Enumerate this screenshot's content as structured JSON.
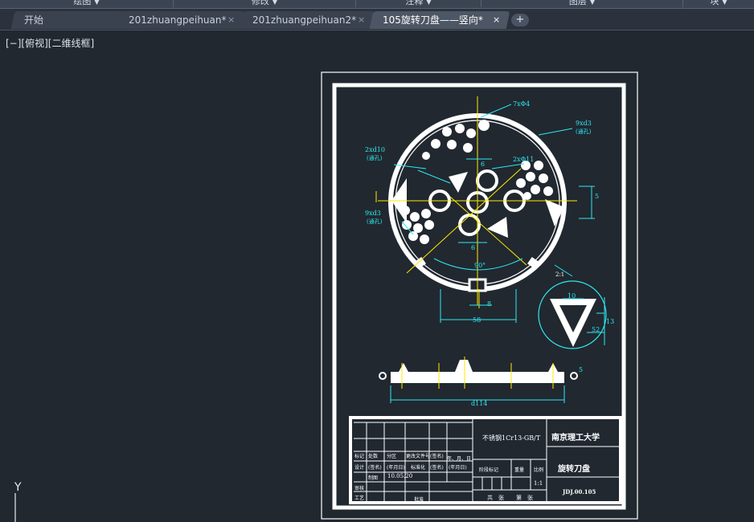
{
  "ribbon": {
    "panels": [
      {
        "label": "绘图"
      },
      {
        "label": "修改"
      },
      {
        "label": "注释"
      },
      {
        "label": "图层"
      },
      {
        "label": "块"
      }
    ]
  },
  "tabs": [
    {
      "label": "开始",
      "closable": false,
      "active": false
    },
    {
      "label": "201zhuangpeihuan*",
      "closable": true,
      "active": false
    },
    {
      "label": "201zhuangpeihuan2*",
      "closable": true,
      "active": false
    },
    {
      "label": "105旋转刀盘——竖向*",
      "closable": true,
      "active": true
    }
  ],
  "new_tab_symbol": "+",
  "close_symbol": "×",
  "viewport": {
    "label": "[−][俯视][二维线框]"
  },
  "ucs": {
    "y_label": "Y"
  },
  "annotations": {
    "holes_7": "7xΦ4",
    "holes_9_top": "9xd3",
    "holes_9_top_note": "(通孔)",
    "holes_2_left": "2xd10",
    "holes_2_left_note": "(通孔)",
    "holes_2_right": "2xΦ11",
    "holes_9_left": "9xd3",
    "holes_9_left_note": "(通孔)",
    "dim_6_top": "6",
    "dim_6_mid": "6",
    "dim_angle": "90°",
    "dim_8": "8",
    "dim_58": "58",
    "dim_d114": "d114",
    "dim_10": "10",
    "dim_5a": "5",
    "dim_5b": "5",
    "dim_2to1": "2:1",
    "dim_13": "13",
    "dim_52": "52"
  },
  "title_block": {
    "material": "不锈钢1Cr13-GB/T",
    "university": "南京理工大学",
    "part_name": "旋转刀盘",
    "drawing_no": "JDJ.00.105",
    "scale": "1:1",
    "date_sample": "10.05.20",
    "labels": {
      "biaoji": "标记",
      "chushu": "处数",
      "fenqu": "分区",
      "gengai": "更改文件号",
      "qianming": "(签名)",
      "nianyueri": "年、月、日",
      "sheji": "设计",
      "qianming2": "(签名)",
      "nyr": "(年月日)",
      "biaozhunhua": "标准化",
      "qianming3": "(签名)",
      "nyr2": "(年月日)",
      "jieduan": "阶段标记",
      "zhongliang": "重量",
      "bili": "比例",
      "shenhe": "审核",
      "gongyi": "工艺",
      "pizhun": "批准",
      "gong": "共",
      "zhang": "张",
      "di": "第",
      "zhang2": "张",
      "zhitu": "制图"
    }
  }
}
